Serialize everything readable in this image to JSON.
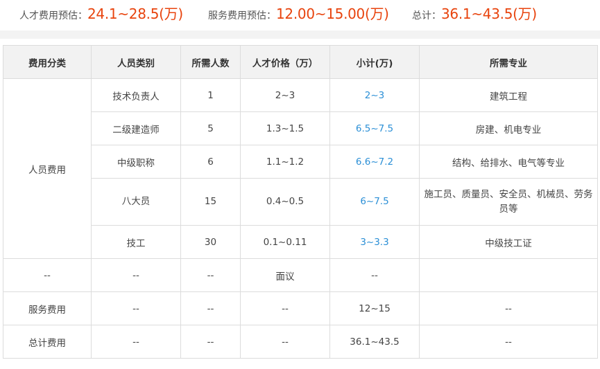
{
  "summary": {
    "talent_label": "人才费用预估：",
    "talent_value": "24.1~28.5(万)",
    "service_label": "服务费用预估：",
    "service_value": "12.00~15.00(万)",
    "total_label": "总计：",
    "total_value": "36.1~43.5(万)"
  },
  "table": {
    "headers": [
      "费用分类",
      "人员类别",
      "所需人数",
      "人才价格（万）",
      "小计(万)",
      "所需专业"
    ],
    "group_label": "人员费用",
    "rows": [
      {
        "category": "技术负责人",
        "count": "1",
        "price": "2~3",
        "subtotal": "2~3",
        "major": "建筑工程"
      },
      {
        "category": "二级建造师",
        "count": "5",
        "price": "1.3~1.5",
        "subtotal": "6.5~7.5",
        "major": "房建、机电专业"
      },
      {
        "category": "中级职称",
        "count": "6",
        "price": "1.1~1.2",
        "subtotal": "6.6~7.2",
        "major": "结构、给排水、电气等专业"
      },
      {
        "category": "八大员",
        "count": "15",
        "price": "0.4~0.5",
        "subtotal": "6~7.5",
        "major": "施工员、质量员、安全员、机械员、劳务员等"
      },
      {
        "category": "技工",
        "count": "30",
        "price": "0.1~0.11",
        "subtotal": "3~3.3",
        "major": "中级技工证"
      }
    ],
    "misc_row": {
      "col1": "--",
      "col2": "--",
      "col3": "--",
      "col4": "面议",
      "col5": "--",
      "col6": ""
    },
    "service_row": {
      "col1": "服务费用",
      "col2": "--",
      "col3": "--",
      "col4": "--",
      "col5": "12~15",
      "col6": "--"
    },
    "total_row": {
      "col1": "总计费用",
      "col2": "--",
      "col3": "--",
      "col4": "--",
      "col5": "36.1~43.5",
      "col6": "--"
    }
  },
  "colors": {
    "accent": "#e8430d",
    "link_blue": "#2b8fd6",
    "header_bg": "#f2f2f2",
    "border": "#dcdcdc"
  }
}
